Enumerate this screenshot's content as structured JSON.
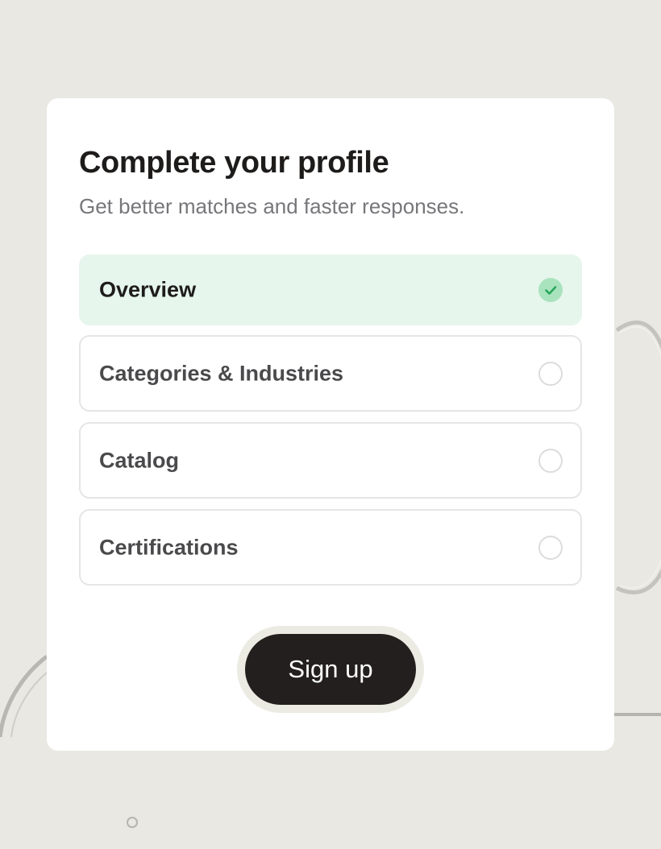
{
  "profile": {
    "title": "Complete your profile",
    "subtitle": "Get better matches and faster responses."
  },
  "steps": [
    {
      "label": "Overview",
      "completed": true,
      "icon": "check-circle-icon"
    },
    {
      "label": "Categories & Industries",
      "completed": false,
      "icon": "empty-circle-icon"
    },
    {
      "label": "Catalog",
      "completed": false,
      "icon": "empty-circle-icon"
    },
    {
      "label": "Certifications",
      "completed": false,
      "icon": "empty-circle-icon"
    }
  ],
  "actions": {
    "signup_label": "Sign up"
  },
  "colors": {
    "background": "#e9e8e2",
    "card": "#ffffff",
    "completed_row": "#e6f6ec",
    "check_badge": "#a9e3be",
    "check_mark": "#28a85a",
    "button": "#221f1e",
    "button_ring": "#ecebe3",
    "title_text": "#1e1c1b",
    "subtitle_text": "#77767a"
  }
}
